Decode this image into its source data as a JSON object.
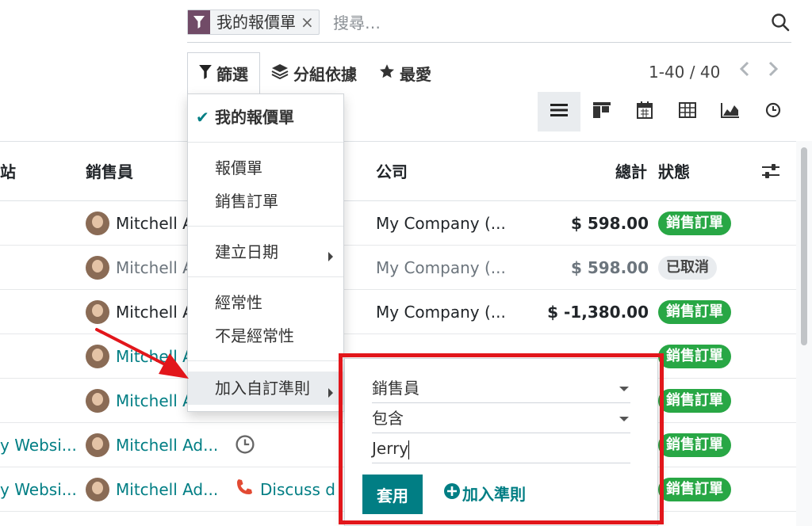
{
  "search": {
    "facet_label": "我的報價單",
    "facet_close": "×",
    "placeholder": "搜尋…"
  },
  "toolbar": {
    "filters_label": "篩選",
    "groupby_label": "分組依據",
    "favorites_label": "最愛",
    "pager": "1-40 / 40"
  },
  "views": [
    "list-icon",
    "kanban-icon",
    "calendar-icon",
    "pivot-icon",
    "graph-icon",
    "activity-icon"
  ],
  "columns": {
    "website": "站",
    "salesperson": "銷售員",
    "company": "公司",
    "total": "總計",
    "status": "狀態"
  },
  "rows": [
    {
      "website": "",
      "salesperson": "Mitchell A",
      "company": "My Company (...",
      "total": "$ 598.00",
      "status": "銷售訂單"
    },
    {
      "website": "",
      "salesperson": "Mitchell A",
      "company": "My Company (...",
      "total": "$ 598.00",
      "status": "已取消"
    },
    {
      "website": "",
      "salesperson": "Mitchell A",
      "company": "My Company (...",
      "total": "$ -1,380.00",
      "status": "銷售訂單"
    },
    {
      "website": "",
      "salesperson": "Mitchell A",
      "company": "",
      "total": "",
      "status": "銷售訂單"
    },
    {
      "website": "",
      "salesperson": "Mitchell A",
      "company": "",
      "total": "",
      "status": "銷售訂單"
    },
    {
      "website": "y Websi...",
      "salesperson": "Mitchell Ad...",
      "company": "",
      "total": "",
      "status": "銷售訂單"
    },
    {
      "website": "y Websi...",
      "salesperson": "Mitchell Ad...",
      "company": "Discuss d",
      "total": "",
      "status": "銷售訂單"
    }
  ],
  "filter_menu": {
    "my_quotations": "我的報價單",
    "check": "✔",
    "quotations": "報價單",
    "sales_orders": "銷售訂單",
    "creation_date": "建立日期",
    "recurring": "經常性",
    "non_recurring": "不是經常性",
    "add_custom": "加入自訂準則"
  },
  "custom_rule": {
    "field": "銷售員",
    "operator": "包含",
    "value": "Jerry",
    "apply": "套用",
    "add_rule": "加入準則"
  },
  "colors": {
    "brand": "#714b67",
    "primary": "#017e84",
    "success": "#28a745",
    "highlight": "#e2161b"
  }
}
